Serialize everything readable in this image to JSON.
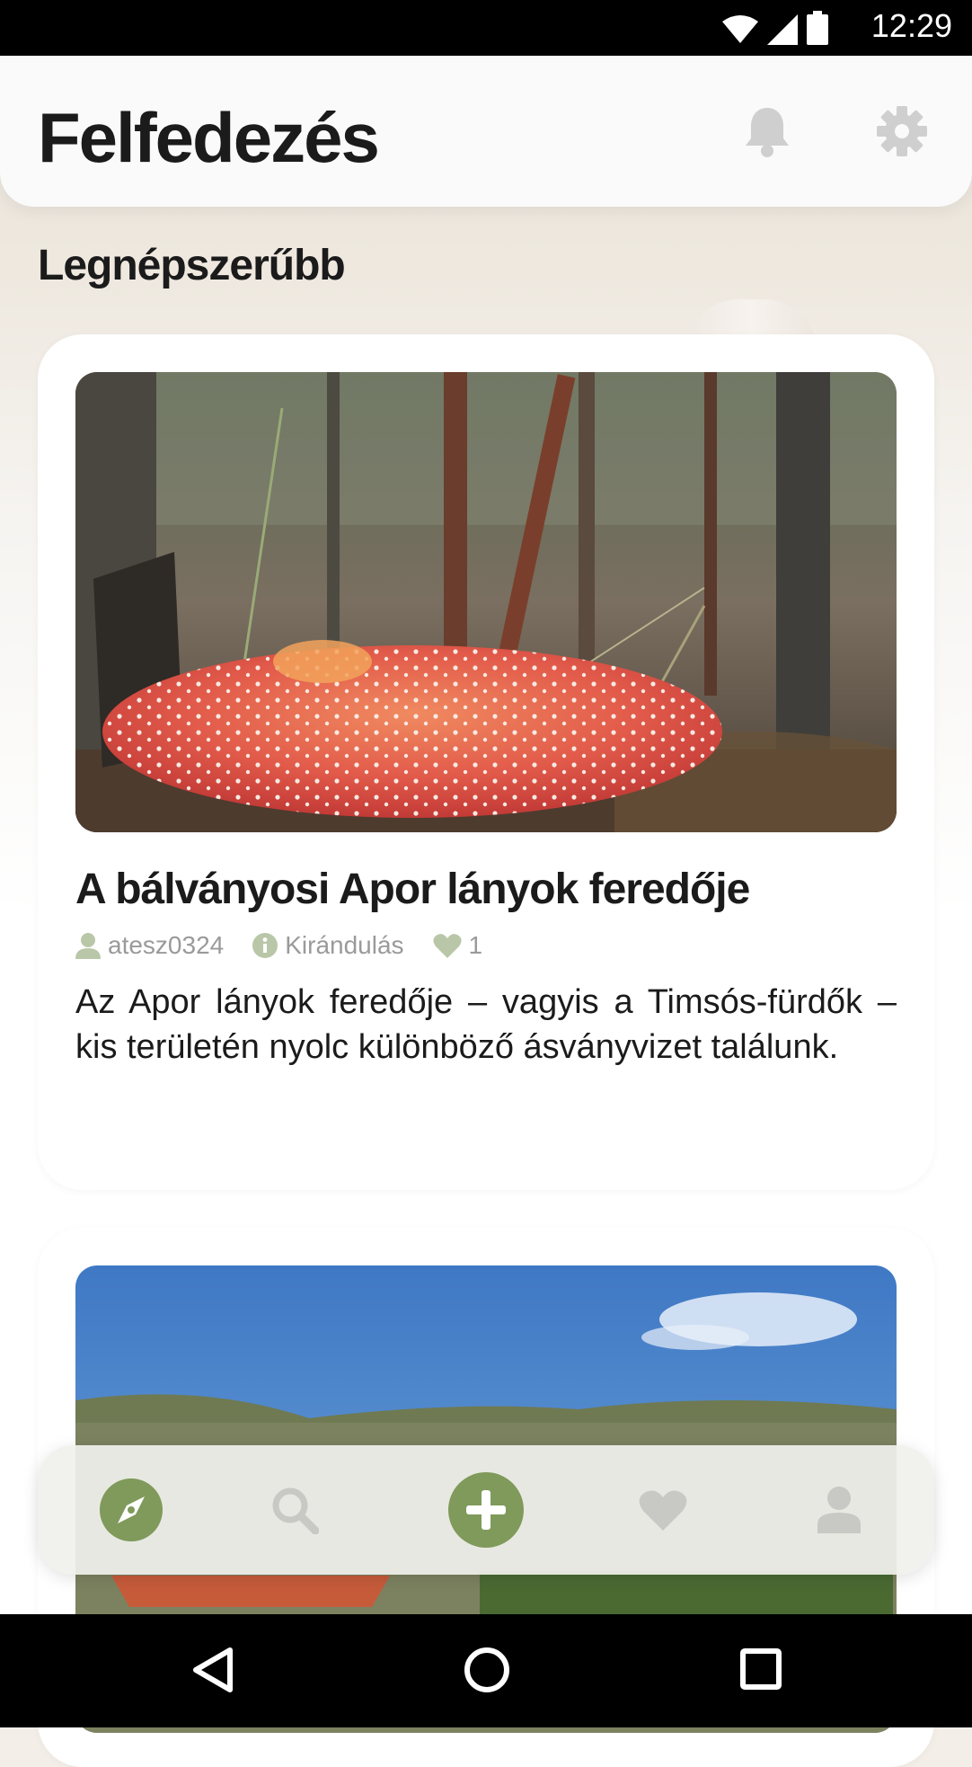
{
  "status_bar": {
    "time": "12:29"
  },
  "header": {
    "title": "Felfedezés"
  },
  "section": {
    "title": "Legnépszerűbb"
  },
  "posts": [
    {
      "title": "A bálványosi Apor lányok feredője",
      "author": "atesz0324",
      "category": "Kirándulás",
      "likes": "1",
      "excerpt": "Az Apor lányok feredője – vagyis a Timsós-fürdők – kis területén nyolc különböző ásványvizet találunk."
    }
  ],
  "bottom_nav": {
    "items": [
      "compass-icon",
      "search-icon",
      "add-icon",
      "heart-icon",
      "person-icon"
    ],
    "active": "compass-icon"
  },
  "colors": {
    "accent_green": "#7f9a5a",
    "inactive_icon": "#c8c8c4",
    "meta_icon": "#b4c4a0"
  }
}
